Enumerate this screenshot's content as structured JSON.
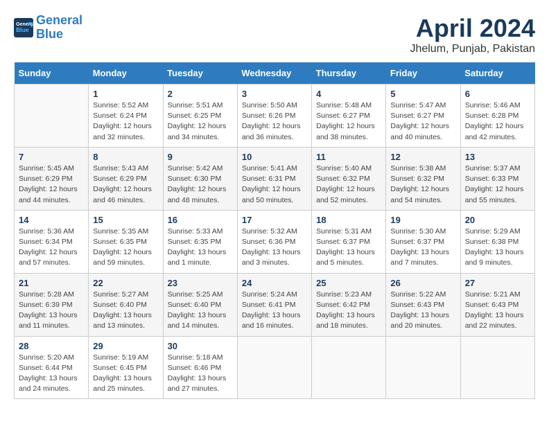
{
  "logo": {
    "line1": "General",
    "line2": "Blue"
  },
  "title": "April 2024",
  "subtitle": "Jhelum, Punjab, Pakistan",
  "weekdays": [
    "Sunday",
    "Monday",
    "Tuesday",
    "Wednesday",
    "Thursday",
    "Friday",
    "Saturday"
  ],
  "weeks": [
    [
      {
        "day": "",
        "info": ""
      },
      {
        "day": "1",
        "info": "Sunrise: 5:52 AM\nSunset: 6:24 PM\nDaylight: 12 hours\nand 32 minutes."
      },
      {
        "day": "2",
        "info": "Sunrise: 5:51 AM\nSunset: 6:25 PM\nDaylight: 12 hours\nand 34 minutes."
      },
      {
        "day": "3",
        "info": "Sunrise: 5:50 AM\nSunset: 6:26 PM\nDaylight: 12 hours\nand 36 minutes."
      },
      {
        "day": "4",
        "info": "Sunrise: 5:48 AM\nSunset: 6:27 PM\nDaylight: 12 hours\nand 38 minutes."
      },
      {
        "day": "5",
        "info": "Sunrise: 5:47 AM\nSunset: 6:27 PM\nDaylight: 12 hours\nand 40 minutes."
      },
      {
        "day": "6",
        "info": "Sunrise: 5:46 AM\nSunset: 6:28 PM\nDaylight: 12 hours\nand 42 minutes."
      }
    ],
    [
      {
        "day": "7",
        "info": "Sunrise: 5:45 AM\nSunset: 6:29 PM\nDaylight: 12 hours\nand 44 minutes."
      },
      {
        "day": "8",
        "info": "Sunrise: 5:43 AM\nSunset: 6:29 PM\nDaylight: 12 hours\nand 46 minutes."
      },
      {
        "day": "9",
        "info": "Sunrise: 5:42 AM\nSunset: 6:30 PM\nDaylight: 12 hours\nand 48 minutes."
      },
      {
        "day": "10",
        "info": "Sunrise: 5:41 AM\nSunset: 6:31 PM\nDaylight: 12 hours\nand 50 minutes."
      },
      {
        "day": "11",
        "info": "Sunrise: 5:40 AM\nSunset: 6:32 PM\nDaylight: 12 hours\nand 52 minutes."
      },
      {
        "day": "12",
        "info": "Sunrise: 5:38 AM\nSunset: 6:32 PM\nDaylight: 12 hours\nand 54 minutes."
      },
      {
        "day": "13",
        "info": "Sunrise: 5:37 AM\nSunset: 6:33 PM\nDaylight: 12 hours\nand 55 minutes."
      }
    ],
    [
      {
        "day": "14",
        "info": "Sunrise: 5:36 AM\nSunset: 6:34 PM\nDaylight: 12 hours\nand 57 minutes."
      },
      {
        "day": "15",
        "info": "Sunrise: 5:35 AM\nSunset: 6:35 PM\nDaylight: 12 hours\nand 59 minutes."
      },
      {
        "day": "16",
        "info": "Sunrise: 5:33 AM\nSunset: 6:35 PM\nDaylight: 13 hours\nand 1 minute."
      },
      {
        "day": "17",
        "info": "Sunrise: 5:32 AM\nSunset: 6:36 PM\nDaylight: 13 hours\nand 3 minutes."
      },
      {
        "day": "18",
        "info": "Sunrise: 5:31 AM\nSunset: 6:37 PM\nDaylight: 13 hours\nand 5 minutes."
      },
      {
        "day": "19",
        "info": "Sunrise: 5:30 AM\nSunset: 6:37 PM\nDaylight: 13 hours\nand 7 minutes."
      },
      {
        "day": "20",
        "info": "Sunrise: 5:29 AM\nSunset: 6:38 PM\nDaylight: 13 hours\nand 9 minutes."
      }
    ],
    [
      {
        "day": "21",
        "info": "Sunrise: 5:28 AM\nSunset: 6:39 PM\nDaylight: 13 hours\nand 11 minutes."
      },
      {
        "day": "22",
        "info": "Sunrise: 5:27 AM\nSunset: 6:40 PM\nDaylight: 13 hours\nand 13 minutes."
      },
      {
        "day": "23",
        "info": "Sunrise: 5:25 AM\nSunset: 6:40 PM\nDaylight: 13 hours\nand 14 minutes."
      },
      {
        "day": "24",
        "info": "Sunrise: 5:24 AM\nSunset: 6:41 PM\nDaylight: 13 hours\nand 16 minutes."
      },
      {
        "day": "25",
        "info": "Sunrise: 5:23 AM\nSunset: 6:42 PM\nDaylight: 13 hours\nand 18 minutes."
      },
      {
        "day": "26",
        "info": "Sunrise: 5:22 AM\nSunset: 6:43 PM\nDaylight: 13 hours\nand 20 minutes."
      },
      {
        "day": "27",
        "info": "Sunrise: 5:21 AM\nSunset: 6:43 PM\nDaylight: 13 hours\nand 22 minutes."
      }
    ],
    [
      {
        "day": "28",
        "info": "Sunrise: 5:20 AM\nSunset: 6:44 PM\nDaylight: 13 hours\nand 24 minutes."
      },
      {
        "day": "29",
        "info": "Sunrise: 5:19 AM\nSunset: 6:45 PM\nDaylight: 13 hours\nand 25 minutes."
      },
      {
        "day": "30",
        "info": "Sunrise: 5:18 AM\nSunset: 6:46 PM\nDaylight: 13 hours\nand 27 minutes."
      },
      {
        "day": "",
        "info": ""
      },
      {
        "day": "",
        "info": ""
      },
      {
        "day": "",
        "info": ""
      },
      {
        "day": "",
        "info": ""
      }
    ]
  ]
}
